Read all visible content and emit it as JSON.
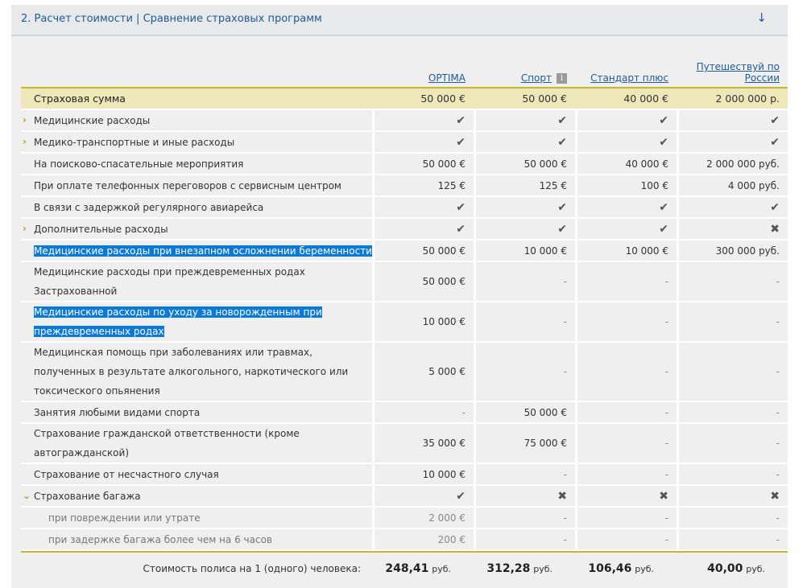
{
  "section": {
    "title": "2. Расчет стоимости | Сравнение страховых программ",
    "toggle": "↓"
  },
  "columns": [
    {
      "name": "OPTIMA",
      "info": false
    },
    {
      "name": "Спорт",
      "info": true
    },
    {
      "name": "Стандарт плюс",
      "info": false
    },
    {
      "name": "Путешествуй по России",
      "info": false
    }
  ],
  "info_icon": "i",
  "sum_row": {
    "label": "Страховая сумма",
    "values": [
      "50 000 €",
      "50 000 €",
      "40 000 €",
      "2 000 000 р."
    ]
  },
  "rows": [
    {
      "label": "Медицинские расходы",
      "chev": "›",
      "values": [
        "✔",
        "✔",
        "✔",
        "✔"
      ],
      "hl": false
    },
    {
      "label": "Медико-транспортные и иные расходы",
      "chev": "›",
      "values": [
        "✔",
        "✔",
        "✔",
        "✔"
      ],
      "hl": false
    },
    {
      "label": "На поисково-спасательные мероприятия",
      "values": [
        "50 000 €",
        "50 000 €",
        "40 000 €",
        "2 000 000 руб."
      ],
      "hl": false
    },
    {
      "label": "При оплате телефонных переговоров с сервисным центром",
      "values": [
        "125 €",
        "125 €",
        "100 €",
        "4 000 руб."
      ],
      "hl": false
    },
    {
      "label": "В связи с задержкой регулярного авиарейса",
      "values": [
        "✔",
        "✔",
        "✔",
        "✔"
      ],
      "hl": false
    },
    {
      "label": "Дополнительные расходы",
      "chev": "›",
      "values": [
        "✔",
        "✔",
        "✔",
        "✖"
      ],
      "hl": false
    },
    {
      "label": "Медицинские расходы при внезапном осложнении беременности",
      "values": [
        "50 000 €",
        "10 000 €",
        "10 000 €",
        "300 000 руб."
      ],
      "hl": true
    },
    {
      "label": "Медицинские расходы при преждевременных родах Застрахованной",
      "values": [
        "50 000 €",
        "-",
        "-",
        "-"
      ],
      "hl": false
    },
    {
      "label": "Медицинские расходы по уходу за новорожденным при преждевременных родах",
      "values": [
        "10 000 €",
        "-",
        "-",
        "-"
      ],
      "hl": true
    },
    {
      "label": "Медицинская помощь при заболеваниях или травмах, полученных в результате алкогольного, наркотического или токсического опьянения",
      "values": [
        "5 000 €",
        "-",
        "-",
        "-"
      ],
      "hl": false
    },
    {
      "label": "Занятия любыми видами спорта",
      "values": [
        "-",
        "50 000 €",
        "-",
        "-"
      ],
      "hl": false
    },
    {
      "label": "Страхование гражданской ответственности (кроме автогражданской)",
      "values": [
        "35 000 €",
        "75 000 €",
        "-",
        "-"
      ],
      "hl": false
    },
    {
      "label": "Страхование от несчастного случая",
      "values": [
        "10 000 €",
        "-",
        "-",
        "-"
      ],
      "hl": false
    },
    {
      "label": "Страхование багажа",
      "chev": "⌄",
      "values": [
        "✔",
        "✖",
        "✖",
        "✖"
      ],
      "hl": false
    },
    {
      "label": "при повреждении или утрате",
      "sub": true,
      "values": [
        "2 000 €",
        "-",
        "-",
        "-"
      ],
      "hl": false
    },
    {
      "label": "при задержке багажа более чем на 6 часов",
      "sub": true,
      "values": [
        "200 €",
        "-",
        "-",
        "-"
      ],
      "hl": false
    }
  ],
  "footer": {
    "label": "Стоимость полиса на 1 (одного) человека:",
    "prices": [
      {
        "amount": "248,41",
        "unit": "руб."
      },
      {
        "amount": "312,28",
        "unit": "руб."
      },
      {
        "amount": "106,46",
        "unit": "руб."
      },
      {
        "amount": "40,00",
        "unit": "руб."
      }
    ]
  },
  "colors": {
    "accent": "#1e5a96",
    "highlight": "#0a79d8",
    "sum_bg": "#eee7b8",
    "rule": "#c9b43a",
    "chevron": "#c29c14"
  }
}
